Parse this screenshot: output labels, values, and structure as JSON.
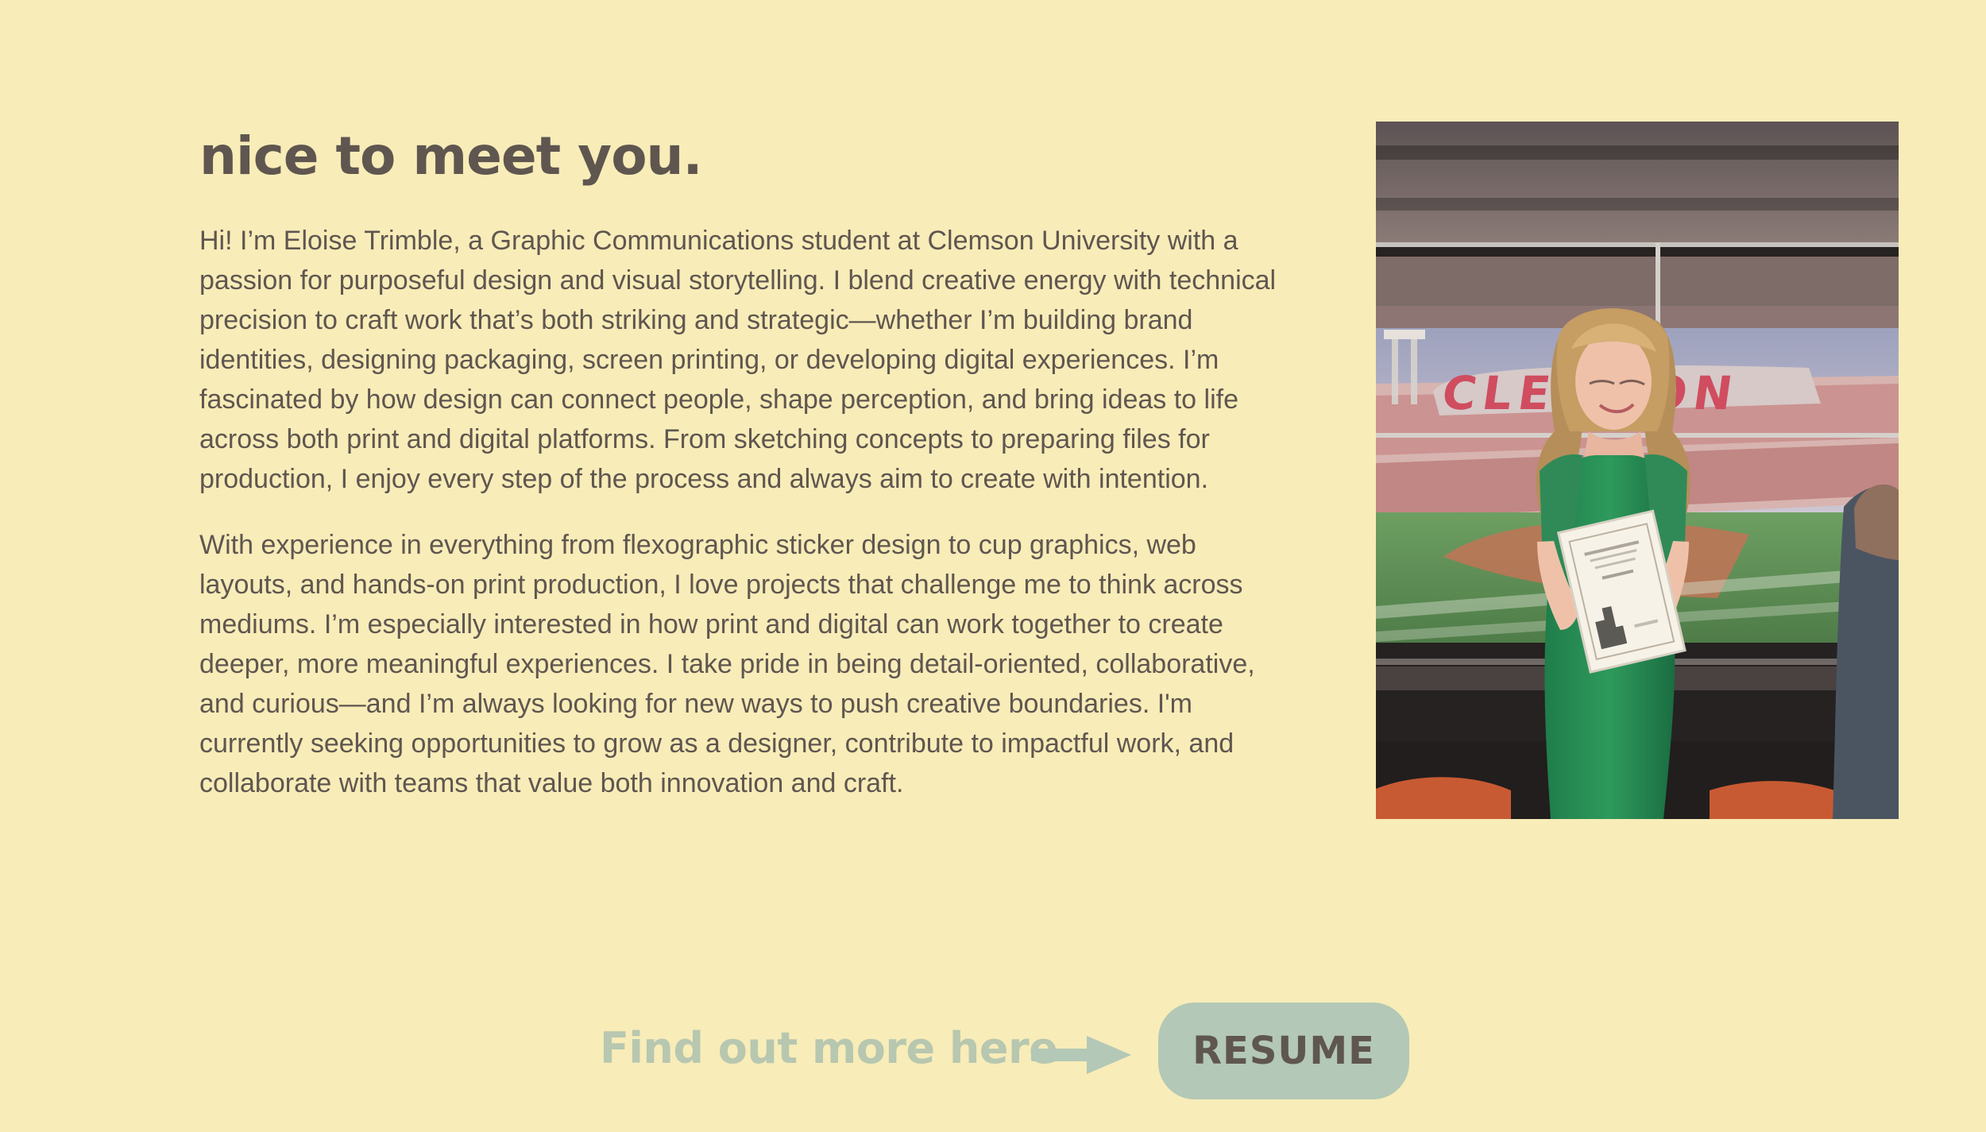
{
  "about": {
    "title": "nice to meet you.",
    "paragraphs": [
      "Hi! I’m Eloise Trimble, a Graphic Communications student at Clemson University with a passion for purposeful design and visual storytelling. I blend creative energy with technical precision to craft work that’s both striking and strategic—whether I’m building brand identities, designing packaging, screen printing, or developing digital experiences. I’m fascinated by how design can connect people, shape perception, and bring ideas to life across both print and digital platforms. From sketching concepts to preparing files for production, I enjoy every step of the process and always aim to create with intention.",
      "With experience in everything from flexographic sticker design to cup graphics, web layouts, and hands-on print production, I love projects that challenge me to think across mediums. I’m especially interested in how print and digital can work together to create deeper, more meaningful experiences. I take pride in being detail-oriented, collaborative, and curious—and I’m always looking for new ways to push creative boundaries. I'm currently seeking opportunities to grow as a designer, contribute to impactful work, and collaborate with teams that value both innovation and craft."
    ]
  },
  "photo": {
    "icon": "portrait-photo",
    "stadium_sign": "CLEMSON"
  },
  "cta": {
    "prompt": "Find out more here",
    "arrow_icon": "arrow-right-icon",
    "button_label": "RESUME"
  },
  "colors": {
    "background": "#f8ecb8",
    "text": "#5f5650",
    "accent_sage": "#b3c8b6"
  }
}
